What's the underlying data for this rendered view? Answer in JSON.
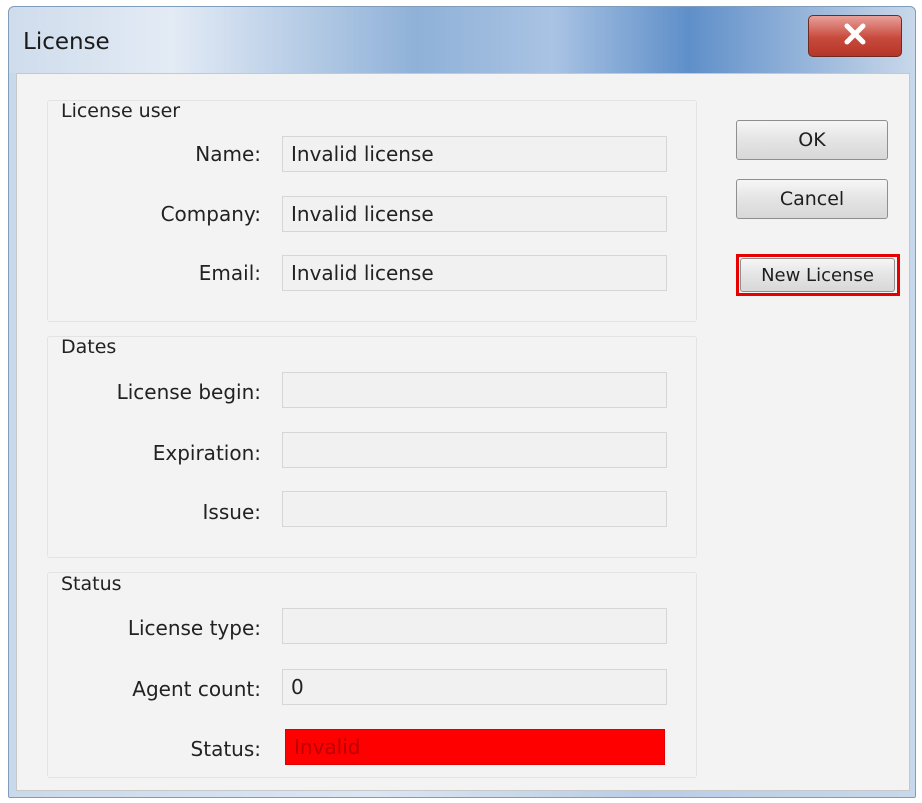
{
  "window": {
    "title": "License",
    "close_icon": "close-icon"
  },
  "groups": {
    "license_user": {
      "label": "License user",
      "name_label": "Name:",
      "name_value": "Invalid license",
      "company_label": "Company:",
      "company_value": "Invalid license",
      "email_label": "Email:",
      "email_value": "Invalid license"
    },
    "dates": {
      "label": "Dates",
      "begin_label": "License begin:",
      "begin_value": "",
      "expiration_label": "Expiration:",
      "expiration_value": "",
      "issue_label": "Issue:",
      "issue_value": ""
    },
    "status": {
      "label": "Status",
      "type_label": "License type:",
      "type_value": "",
      "agent_count_label": "Agent count:",
      "agent_count_value": "0",
      "status_label": "Status:",
      "status_value": "Invalid",
      "status_color": "#ff0000"
    }
  },
  "buttons": {
    "ok": "OK",
    "cancel": "Cancel",
    "new_license": "New License",
    "highlight_color": "#e60000"
  }
}
